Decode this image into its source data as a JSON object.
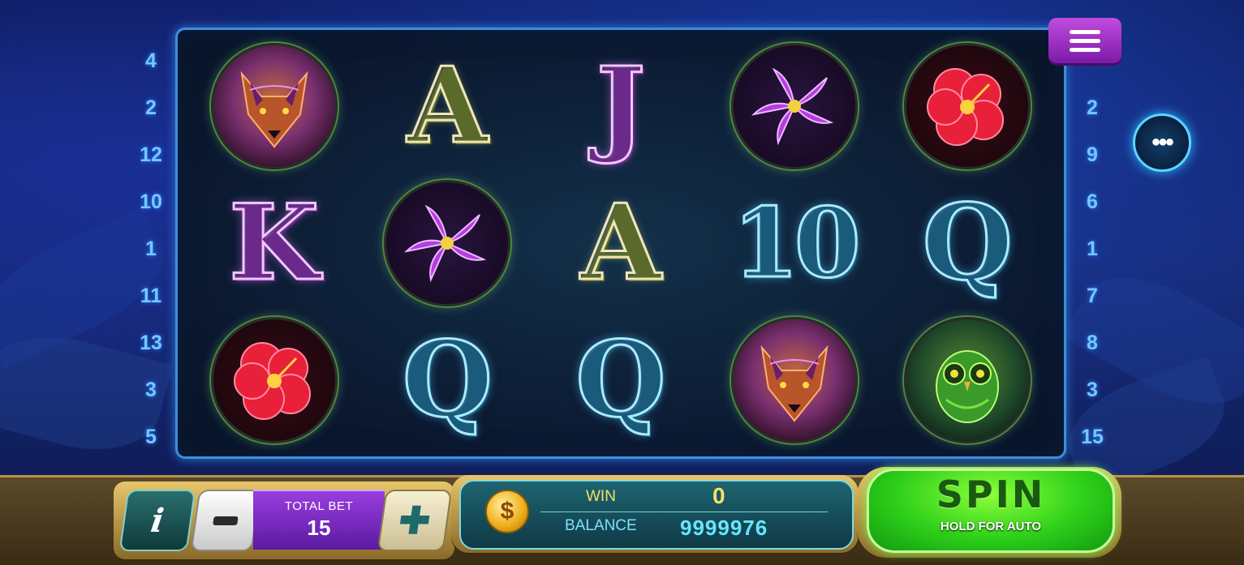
{
  "paylines_left": [
    "4",
    "2",
    "12",
    "10",
    "1",
    "11",
    "13",
    "3",
    "5"
  ],
  "paylines_right": [
    "2",
    "9",
    "6",
    "1",
    "7",
    "8",
    "3",
    "15"
  ],
  "reels": [
    [
      {
        "kind": "medallion",
        "name": "wolf"
      },
      {
        "kind": "letter",
        "text": "A",
        "tone": "gold"
      },
      {
        "kind": "letter",
        "text": "J",
        "tone": "pink"
      },
      {
        "kind": "medallion",
        "name": "lily"
      },
      {
        "kind": "medallion",
        "name": "hibiscus"
      }
    ],
    [
      {
        "kind": "letter",
        "text": "K",
        "tone": "pink"
      },
      {
        "kind": "medallion",
        "name": "lily"
      },
      {
        "kind": "letter",
        "text": "A",
        "tone": "gold"
      },
      {
        "kind": "letter",
        "text": "10",
        "tone": "cyan"
      },
      {
        "kind": "letter",
        "text": "Q",
        "tone": "cyan"
      }
    ],
    [
      {
        "kind": "medallion",
        "name": "hibiscus"
      },
      {
        "kind": "letter",
        "text": "Q",
        "tone": "cyan"
      },
      {
        "kind": "letter",
        "text": "Q",
        "tone": "cyan"
      },
      {
        "kind": "medallion",
        "name": "wolf"
      },
      {
        "kind": "medallion",
        "name": "owl"
      }
    ]
  ],
  "controls": {
    "info_label": "i",
    "total_bet_label": "TOTAL BET",
    "total_bet_value": "15",
    "plus_label": "✚",
    "coin_symbol": "$",
    "win_label": "WIN",
    "win_value": "0",
    "balance_label": "BALANCE",
    "balance_value": "9999976",
    "spin_label": "SPIN",
    "spin_sub": "HOLD FOR AUTO",
    "more_label": "•••"
  },
  "colors": {
    "accent": "#3c8fd8",
    "spin": "#2ed01a",
    "menu": "#9a30c8"
  }
}
